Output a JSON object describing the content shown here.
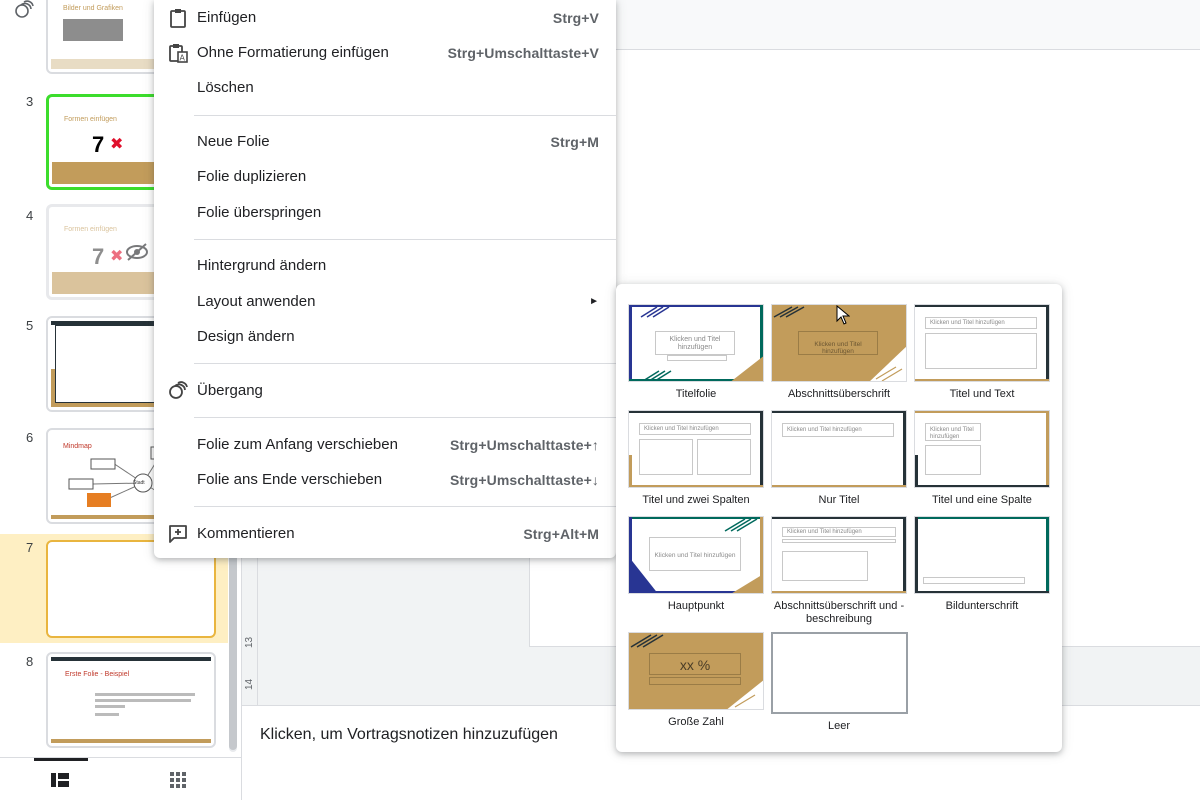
{
  "colors": {
    "accent_selected": "#feefc3",
    "gold": "#c29c5b",
    "dark": "#263238",
    "teal": "#00695c",
    "blue": "#283593"
  },
  "filmstrip": {
    "slides": [
      {
        "number": "",
        "title": "Bilder und Grafiken"
      },
      {
        "number": "3",
        "title": "Formen einfügen",
        "big": "7"
      },
      {
        "number": "4",
        "title": "Formen einfügen",
        "big": "7"
      },
      {
        "number": "5"
      },
      {
        "number": "6",
        "title": "Mindmap",
        "node": "Stadt"
      },
      {
        "number": "7"
      },
      {
        "number": "8",
        "title": "Erste Folie - Beispiel"
      }
    ],
    "view_buttons": [
      "filmstrip-view-icon",
      "grid-view-icon"
    ]
  },
  "ruler": [
    "13",
    "14"
  ],
  "notes": {
    "placeholder": "Klicken, um Vortragsnotizen hinzuzufügen"
  },
  "menu": {
    "items": [
      {
        "label": "Einfügen",
        "shortcut": "Strg+V",
        "icon": "clipboard-icon"
      },
      {
        "label": "Ohne Formatierung einfügen",
        "shortcut": "Strg+Umschalttaste+V",
        "icon": "clipboard-plain-icon"
      },
      {
        "label": "Löschen",
        "shortcut": ""
      },
      {
        "label": "Neue Folie",
        "shortcut": "Strg+M"
      },
      {
        "label": "Folie duplizieren",
        "shortcut": ""
      },
      {
        "label": "Folie überspringen",
        "shortcut": ""
      },
      {
        "label": "Hintergrund ändern",
        "shortcut": ""
      },
      {
        "label": "Layout anwenden",
        "shortcut": "",
        "submenu": "►"
      },
      {
        "label": "Design ändern",
        "shortcut": ""
      },
      {
        "label": "Übergang",
        "shortcut": "",
        "icon": "transition-icon"
      },
      {
        "label": "Folie zum Anfang verschieben",
        "shortcut": "Strg+Umschalttaste+↑"
      },
      {
        "label": "Folie ans Ende verschieben",
        "shortcut": "Strg+Umschalttaste+↓"
      },
      {
        "label": "Kommentieren",
        "shortcut": "Strg+Alt+M",
        "icon": "add-comment-icon"
      }
    ]
  },
  "layouts": {
    "items": [
      {
        "label": "Titelfolie",
        "preview_title": "Klicken und Titel hinzufügen"
      },
      {
        "label": "Abschnittsüberschrift",
        "preview_title": "Klicken und Titel hinzufügen"
      },
      {
        "label": "Titel und Text",
        "preview_title": "Klicken und Titel hinzufügen"
      },
      {
        "label": "Titel und zwei Spalten",
        "preview_title": "Klicken und Titel hinzufügen"
      },
      {
        "label": "Nur Titel",
        "preview_title": "Klicken und Titel hinzufügen"
      },
      {
        "label": "Titel und eine Spalte",
        "preview_title": "Klicken und Titel hinzufügen"
      },
      {
        "label": "Hauptpunkt",
        "preview_title": "Klicken und Titel hinzufügen"
      },
      {
        "label": "Abschnittsüberschrift und -beschreibung",
        "preview_title": "Klicken und Titel hinzufügen"
      },
      {
        "label": "Bildunterschrift",
        "preview_title": ""
      },
      {
        "label": "Große Zahl",
        "preview_title": "xx %"
      },
      {
        "label": "Leer",
        "preview_title": ""
      }
    ]
  }
}
